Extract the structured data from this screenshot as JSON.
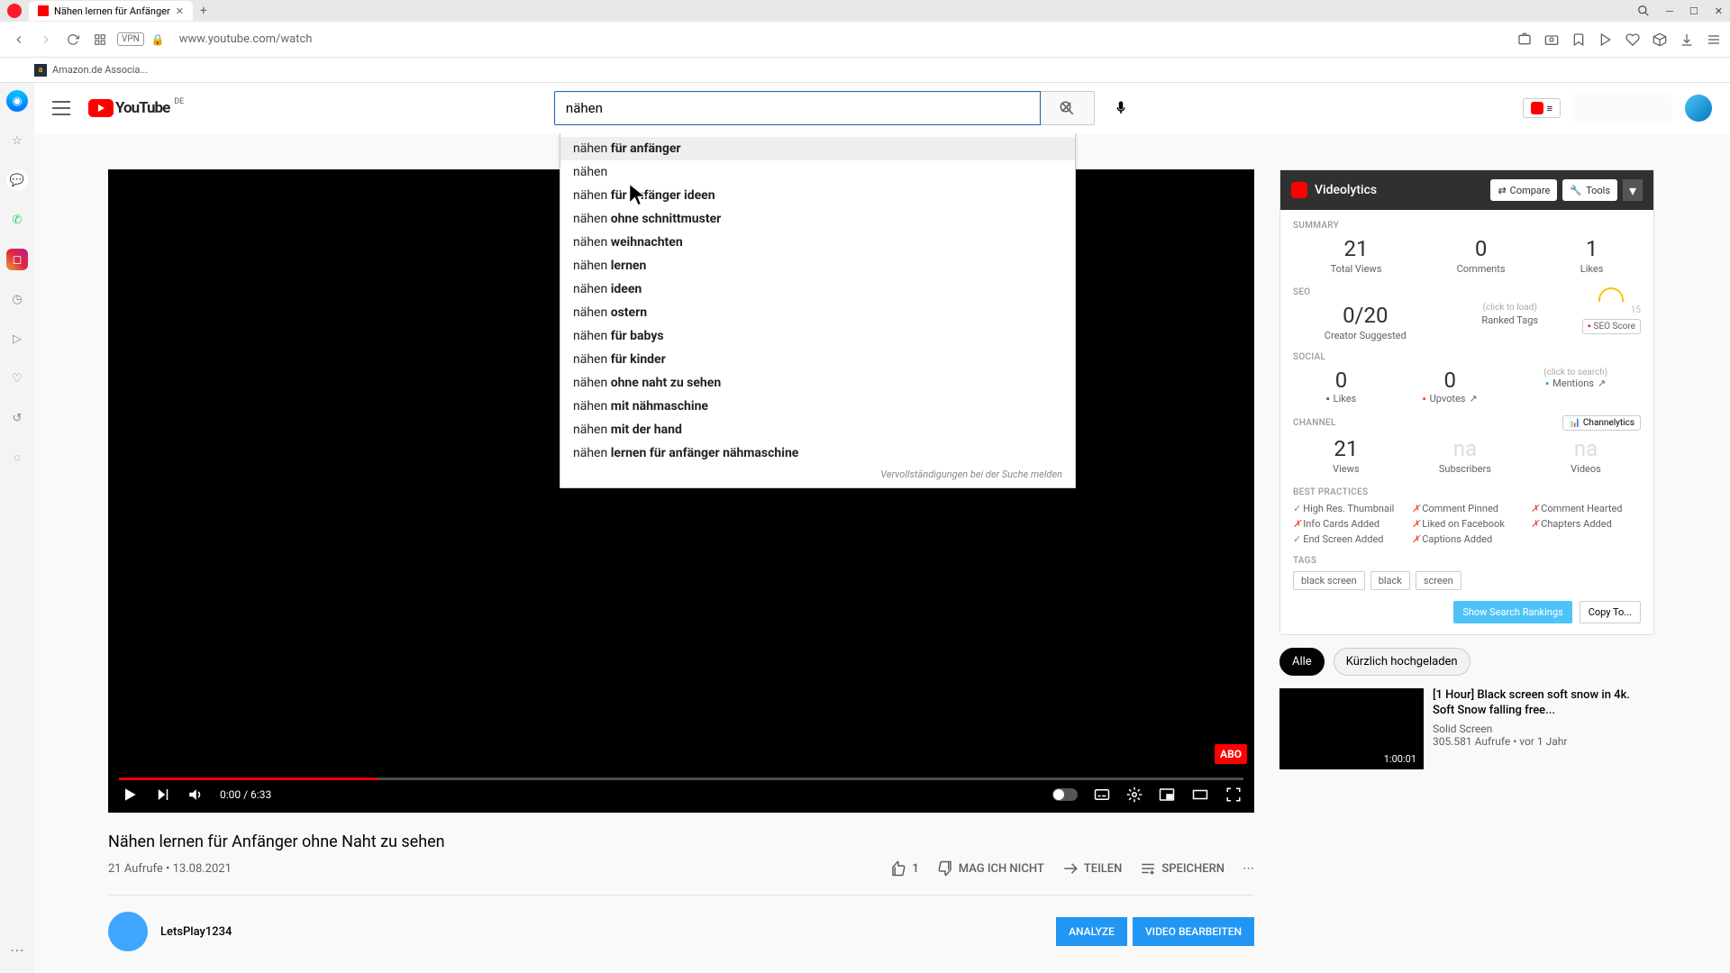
{
  "browser": {
    "tab_title": "Nähen lernen für Anfänger",
    "url": "www.youtube.com/watch",
    "vpn": "VPN",
    "bookmark": "Amazon.de Associa..."
  },
  "header": {
    "logo_text": "YouTube",
    "country": "DE",
    "search_value": "nähen",
    "tb_menu": "≡"
  },
  "suggestions": {
    "items": [
      {
        "prefix": "nähen ",
        "bold": "für anfänger"
      },
      {
        "prefix": "nähen",
        "bold": ""
      },
      {
        "prefix": "nähen ",
        "bold": "für anfänger ideen"
      },
      {
        "prefix": "nähen ",
        "bold": "ohne schnittmuster"
      },
      {
        "prefix": "nähen ",
        "bold": "weihnachten"
      },
      {
        "prefix": "nähen ",
        "bold": "lernen"
      },
      {
        "prefix": "nähen ",
        "bold": "ideen"
      },
      {
        "prefix": "nähen ",
        "bold": "ostern"
      },
      {
        "prefix": "nähen ",
        "bold": "für babys"
      },
      {
        "prefix": "nähen ",
        "bold": "für kinder"
      },
      {
        "prefix": "nähen ",
        "bold": "ohne naht zu sehen"
      },
      {
        "prefix": "nähen ",
        "bold": "mit nähmaschine"
      },
      {
        "prefix": "nähen ",
        "bold": "mit der hand"
      },
      {
        "prefix": "nähen ",
        "bold": "lernen für anfänger nähmaschine"
      }
    ],
    "footer": "Vervollständigungen bei der Suche melden"
  },
  "video": {
    "abo": "ABO",
    "time": "0:00 / 6:33",
    "title": "Nähen lernen für Anfänger ohne Naht zu sehen",
    "views_date": "21 Aufrufe • 13.08.2021",
    "like_count": "1",
    "dislike": "MAG ICH NICHT",
    "share": "TEILEN",
    "save": "SPEICHERN",
    "channel_name": "LetsPlay1234",
    "btn_analyze": "ANALYZE",
    "btn_edit": "VIDEO BEARBEITEN"
  },
  "videolytics": {
    "title": "Videolytics",
    "compare": "Compare",
    "tools": "Tools",
    "summary_label": "SUMMARY",
    "summary": [
      {
        "val": "21",
        "lbl": "Total Views"
      },
      {
        "val": "0",
        "lbl": "Comments"
      },
      {
        "val": "1",
        "lbl": "Likes"
      }
    ],
    "seo_label": "SEO",
    "seo_val": "0/20",
    "seo_lbl": "Creator Suggested",
    "seo_ranked": "Ranked Tags",
    "seo_click": "(click to load)",
    "seo_gauge_val": "15",
    "seo_score": "SEO Score",
    "social_label": "SOCIAL",
    "social_likes_val": "0",
    "social_likes": "Likes",
    "social_upvotes_val": "0",
    "social_upvotes": "Upvotes",
    "social_click": "(click to search)",
    "social_mentions": "Mentions",
    "channel_label": "CHANNEL",
    "channelytics": "Channelytics",
    "channel": [
      {
        "val": "21",
        "lbl": "Views",
        "faded": false
      },
      {
        "val": "na",
        "lbl": "Subscribers",
        "faded": true
      },
      {
        "val": "na",
        "lbl": "Videos",
        "faded": true
      }
    ],
    "best_label": "BEST PRACTICES",
    "best": [
      {
        "ok": true,
        "text": "High Res. Thumbnail"
      },
      {
        "ok": false,
        "text": "Comment Pinned"
      },
      {
        "ok": false,
        "text": "Comment Hearted"
      },
      {
        "ok": false,
        "text": "Info Cards Added"
      },
      {
        "ok": false,
        "text": "Liked on Facebook"
      },
      {
        "ok": false,
        "text": "Chapters Added"
      },
      {
        "ok": true,
        "text": "End Screen Added"
      },
      {
        "ok": false,
        "text": "Captions Added"
      }
    ],
    "tags_label": "TAGS",
    "tags": [
      "black screen",
      "black",
      "screen"
    ],
    "show_rankings": "Show Search Rankings",
    "copy_to": "Copy To..."
  },
  "chips": {
    "all": "Alle",
    "recent": "Kürzlich hochgeladen"
  },
  "related": {
    "title": "[1 Hour] Black screen soft snow in 4k. Soft Snow falling free...",
    "channel": "Solid Screen",
    "meta": "305.581 Aufrufe • vor 1 Jahr",
    "duration": "1:00:01"
  }
}
